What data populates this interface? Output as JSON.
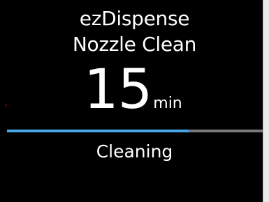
{
  "header": {
    "title_line1": "ezDispense",
    "title_line2": "Nozzle Clean"
  },
  "timer": {
    "value": "15",
    "unit": "min"
  },
  "progress": {
    "fraction": 0.71,
    "fill_color": "#4aa8e8",
    "track_color": "#7a7a7a"
  },
  "status": {
    "label": "Cleaning"
  }
}
